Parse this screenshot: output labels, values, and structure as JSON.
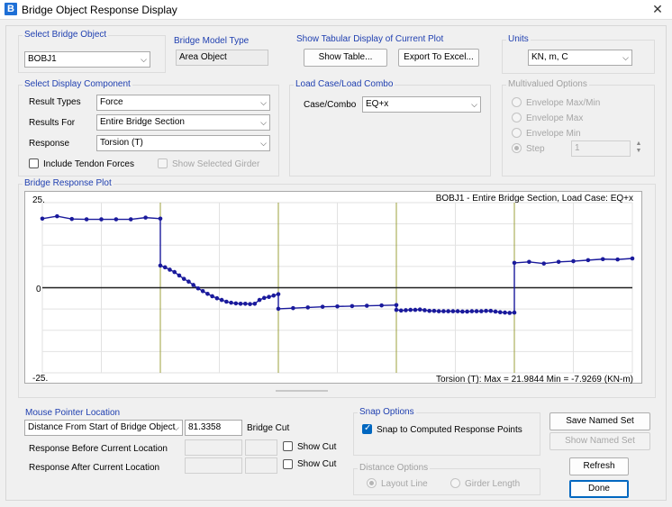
{
  "window": {
    "title": "Bridge Object Response Display",
    "app_icon_letter": "B"
  },
  "select_bridge_object": {
    "label": "Select Bridge Object",
    "value": "BOBJ1"
  },
  "bridge_model_type": {
    "label": "Bridge Model Type",
    "value": "Area Object"
  },
  "tabular_display": {
    "label": "Show Tabular Display of Current Plot",
    "show_table": "Show Table...",
    "export_excel": "Export To Excel..."
  },
  "units": {
    "label": "Units",
    "value": "KN, m, C"
  },
  "display_component": {
    "label": "Select Display Component",
    "result_types_label": "Result Types",
    "result_types_value": "Force",
    "results_for_label": "Results For",
    "results_for_value": "Entire Bridge Section",
    "response_label": "Response",
    "response_value": "Torsion  (T)",
    "include_tendon": "Include Tendon Forces",
    "show_selected_girder": "Show Selected Girder"
  },
  "load_case": {
    "label": "Load Case/Load Combo",
    "case_label": "Case/Combo",
    "case_value": "EQ+x"
  },
  "multivalued": {
    "label": "Multivalued Options",
    "env_maxmin": "Envelope Max/Min",
    "env_max": "Envelope Max",
    "env_min": "Envelope Min",
    "step": "Step",
    "step_value": "1"
  },
  "plot": {
    "label": "Bridge Response Plot",
    "header": "BOBJ1 - Entire Bridge Section,  Load Case: EQ+x",
    "footer": "Torsion  (T):  Max = 21.9844    Min = -7.9269   (KN-m)",
    "ytick_top": "25.",
    "ytick_zero": "0",
    "ytick_bottom": "-25."
  },
  "chart_data": {
    "type": "line",
    "title": "BOBJ1 - Entire Bridge Section,  Load Case: EQ+x",
    "ylabel": "Torsion  (T)",
    "ylim": [
      -25,
      25
    ],
    "xlim": [
      0,
      100
    ],
    "grid": true,
    "series_color": "#1a1a9c",
    "zero_line_color": "#202020",
    "support_line_color": "#9ca03c",
    "supports_x": [
      20,
      40,
      60,
      80
    ],
    "yticks": [
      "25.",
      "0",
      "-25."
    ],
    "stats": {
      "max": 21.9844,
      "min": -7.9269,
      "units": "KN-m"
    },
    "series": [
      {
        "x": [
          0,
          2.5,
          5,
          7.5,
          10,
          12.5,
          15,
          17.5,
          20
        ],
        "y": [
          20.3,
          21.0,
          20.2,
          20.1,
          20.1,
          20.1,
          20.1,
          20.6,
          20.3
        ]
      },
      {
        "x": [
          20,
          20.8,
          21.6,
          22.4,
          23.2,
          24,
          24.8,
          25.6,
          26.4,
          27.2,
          28,
          28.8,
          29.6,
          30.4,
          31.2,
          32,
          32.8,
          33.6,
          34.4,
          35.2,
          36,
          36.8,
          37.6,
          38.4,
          39.2,
          40
        ],
        "y": [
          6.5,
          6.0,
          5.3,
          4.6,
          3.6,
          2.6,
          1.8,
          0.8,
          -0.2,
          -1.0,
          -1.8,
          -2.5,
          -3.1,
          -3.6,
          -4.1,
          -4.4,
          -4.6,
          -4.7,
          -4.7,
          -4.8,
          -4.7,
          -3.6,
          -3.0,
          -2.7,
          -2.3,
          -1.9
        ]
      },
      {
        "x": [
          40,
          42.5,
          45,
          47.5,
          50,
          52.5,
          55,
          57.5,
          60
        ],
        "y": [
          -6.2,
          -6.0,
          -5.8,
          -5.6,
          -5.5,
          -5.4,
          -5.3,
          -5.2,
          -5.1
        ]
      },
      {
        "x": [
          60,
          60.8,
          61.6,
          62.4,
          63.2,
          64,
          64.8,
          65.6,
          66.4,
          67.2,
          68,
          68.8,
          69.6,
          70.4,
          71.2,
          72,
          72.8,
          73.6,
          74.4,
          75.2,
          76,
          76.8,
          77.6,
          78.4,
          79.2,
          80
        ],
        "y": [
          -6.5,
          -6.7,
          -6.6,
          -6.5,
          -6.5,
          -6.4,
          -6.6,
          -6.8,
          -6.8,
          -6.9,
          -6.9,
          -6.9,
          -6.9,
          -6.9,
          -7.0,
          -7.0,
          -6.9,
          -6.9,
          -6.9,
          -6.8,
          -6.8,
          -7.0,
          -7.2,
          -7.3,
          -7.4,
          -7.3
        ]
      },
      {
        "x": [
          80,
          82.5,
          85,
          87.5,
          90,
          92.5,
          95,
          97.5,
          100
        ],
        "y": [
          7.3,
          7.6,
          7.1,
          7.6,
          7.8,
          8.1,
          8.4,
          8.3,
          8.6
        ]
      }
    ]
  },
  "mouse_pointer": {
    "label": "Mouse Pointer Location",
    "distance_select": "Distance From Start of Bridge Object",
    "distance_value": "81.3358",
    "bridge_cut": "Bridge Cut",
    "response_before": "Response Before Current Location",
    "response_after": "Response After Current Location",
    "show_cut": "Show Cut"
  },
  "snap_options": {
    "label": "Snap Options",
    "snap_text": "Snap to Computed Response Points"
  },
  "distance_options": {
    "label": "Distance Options",
    "layout_line": "Layout Line",
    "girder_length": "Girder Length"
  },
  "buttons": {
    "save_named_set": "Save Named Set",
    "show_named_set": "Show Named Set",
    "refresh": "Refresh",
    "done": "Done"
  }
}
